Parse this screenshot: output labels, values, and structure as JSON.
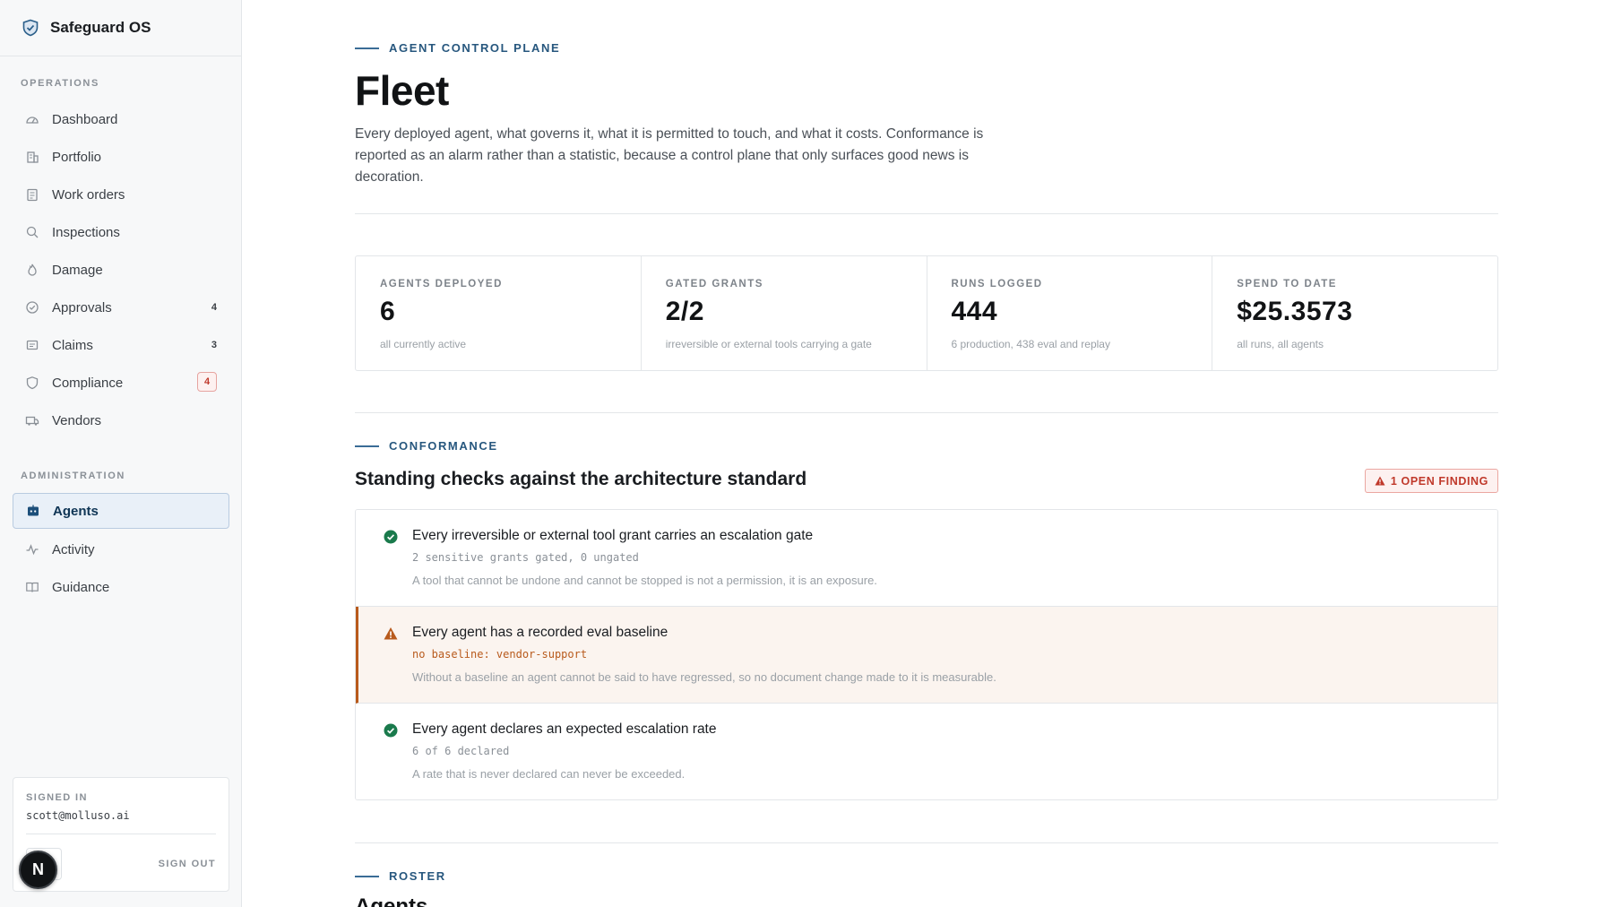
{
  "brand": {
    "name": "Safeguard OS"
  },
  "sidebar": {
    "operations_label": "OPERATIONS",
    "operations": [
      {
        "label": "Dashboard",
        "icon": "gauge-icon"
      },
      {
        "label": "Portfolio",
        "icon": "building-icon"
      },
      {
        "label": "Work orders",
        "icon": "clipboard-icon"
      },
      {
        "label": "Inspections",
        "icon": "search-icon"
      },
      {
        "label": "Damage",
        "icon": "flame-icon"
      },
      {
        "label": "Approvals",
        "icon": "check-circle-icon",
        "count": "4"
      },
      {
        "label": "Claims",
        "icon": "receipt-icon",
        "count": "3"
      },
      {
        "label": "Compliance",
        "icon": "shield-icon",
        "badge": "4"
      },
      {
        "label": "Vendors",
        "icon": "truck-icon"
      }
    ],
    "administration_label": "ADMINISTRATION",
    "administration": [
      {
        "label": "Agents",
        "icon": "agents-icon",
        "active": true
      },
      {
        "label": "Activity",
        "icon": "activity-icon"
      },
      {
        "label": "Guidance",
        "icon": "book-icon"
      }
    ],
    "signed_in_label": "SIGNED IN",
    "email": "scott@molluso.ai",
    "sign_out": "SIGN OUT",
    "avatar_initial": "N"
  },
  "header": {
    "eyebrow": "AGENT CONTROL PLANE",
    "title": "Fleet",
    "intro": "Every deployed agent, what governs it, what it is permitted to touch, and what it costs. Conformance is reported as an alarm rather than a statistic, because a control plane that only surfaces good news is decoration."
  },
  "stats": [
    {
      "label": "AGENTS DEPLOYED",
      "value": "6",
      "sub": "all currently active"
    },
    {
      "label": "GATED GRANTS",
      "value": "2/2",
      "sub": "irreversible or external tools carrying a gate"
    },
    {
      "label": "RUNS LOGGED",
      "value": "444",
      "sub": "6 production, 438 eval and replay"
    },
    {
      "label": "SPEND TO DATE",
      "value": "$25.3573",
      "sub": "all runs, all agents"
    }
  ],
  "conformance": {
    "eyebrow": "CONFORMANCE",
    "heading": "Standing checks against the architecture standard",
    "finding_badge": "1 OPEN FINDING",
    "checks": [
      {
        "status": "pass",
        "title": "Every irreversible or external tool grant carries an escalation gate",
        "meta": "2 sensitive grants gated, 0 ungated",
        "note": "A tool that cannot be undone and cannot be stopped is not a permission, it is an exposure."
      },
      {
        "status": "warn",
        "title": "Every agent has a recorded eval baseline",
        "meta": "no baseline: vendor-support",
        "note": "Without a baseline an agent cannot be said to have regressed, so no document change made to it is measurable."
      },
      {
        "status": "pass",
        "title": "Every agent declares an expected escalation rate",
        "meta": "6 of 6 declared",
        "note": "A rate that is never declared can never be exceeded."
      }
    ]
  },
  "roster": {
    "eyebrow": "ROSTER",
    "title": "Agents"
  },
  "colors": {
    "accent": "#27577e",
    "pass": "#1a7a4c",
    "warn": "#b85a1c",
    "danger": "#c0392b"
  }
}
